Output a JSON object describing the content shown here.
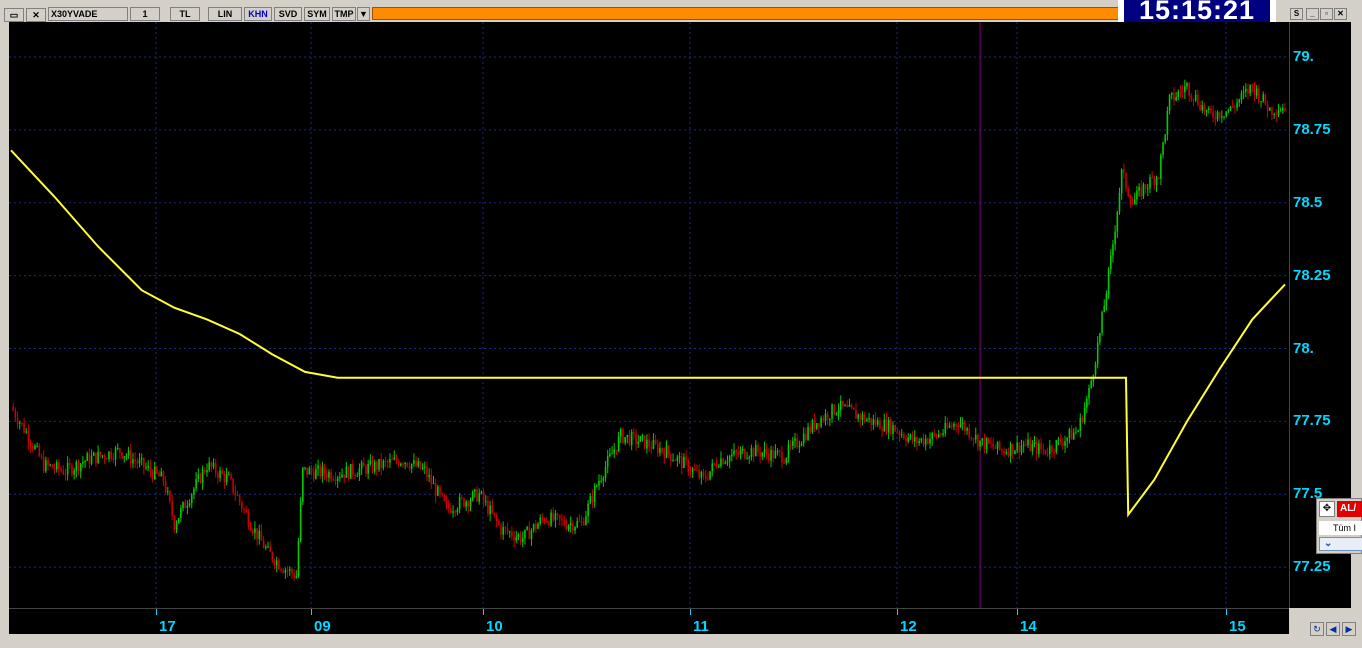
{
  "toolbar": {
    "symbol": "X30YVADE",
    "period": "1",
    "buttons": [
      "TL",
      "LIN",
      "KHN",
      "SVD",
      "SYM",
      "TMP"
    ],
    "active_button": "KHN",
    "dropdown_arrow": "chevron-down-icon"
  },
  "clock": {
    "time": "15:15:21"
  },
  "window_controls": {
    "s_label": "S",
    "minimize": "_",
    "restore": "▫",
    "close": "✕"
  },
  "right_panel": {
    "al_label": "AL/",
    "list_label": "Tüm I"
  },
  "colors": {
    "background": "#000000",
    "grid": "#1a2a80",
    "axis_text": "#00d8ff",
    "candle_up": "#00cc00",
    "candle_down": "#cc0000",
    "moving_average": "#ffff33",
    "cursor_line": "#800080",
    "toolbar_orange": "#ff8c00",
    "clock_bg": "#000080"
  },
  "chart_data": {
    "type": "candlestick",
    "symbol": "X30YVADE",
    "y_ticks": [
      "79.",
      "78.75",
      "78.5",
      "78.25",
      "78.",
      "77.75",
      "77.5",
      "77.25"
    ],
    "y_tick_values": [
      79.0,
      78.75,
      78.5,
      78.25,
      78.0,
      77.75,
      77.5,
      77.25
    ],
    "ylim": [
      77.11,
      79.12
    ],
    "x_ticks": [
      "17",
      "09",
      "10",
      "11",
      "12",
      "14",
      "15"
    ],
    "grid": true,
    "close_path": [
      [
        0,
        77.8
      ],
      [
        8,
        77.7
      ],
      [
        15,
        77.6
      ],
      [
        25,
        77.58
      ],
      [
        35,
        77.62
      ],
      [
        50,
        77.65
      ],
      [
        60,
        77.6
      ],
      [
        70,
        77.55
      ],
      [
        75,
        77.4
      ],
      [
        90,
        77.6
      ],
      [
        100,
        77.55
      ],
      [
        110,
        77.4
      ],
      [
        118,
        77.3
      ],
      [
        125,
        77.25
      ],
      [
        131,
        77.22
      ],
      [
        134,
        77.58
      ],
      [
        150,
        77.57
      ],
      [
        170,
        77.6
      ],
      [
        180,
        77.62
      ],
      [
        190,
        77.58
      ],
      [
        200,
        77.45
      ],
      [
        215,
        77.5
      ],
      [
        225,
        77.38
      ],
      [
        235,
        77.35
      ],
      [
        245,
        77.42
      ],
      [
        255,
        77.4
      ],
      [
        262,
        77.4
      ],
      [
        270,
        77.55
      ],
      [
        280,
        77.7
      ],
      [
        290,
        77.68
      ],
      [
        300,
        77.65
      ],
      [
        310,
        77.6
      ],
      [
        318,
        77.55
      ],
      [
        325,
        77.62
      ],
      [
        340,
        77.65
      ],
      [
        355,
        77.63
      ],
      [
        370,
        77.75
      ],
      [
        380,
        77.8
      ],
      [
        395,
        77.75
      ],
      [
        405,
        77.73
      ],
      [
        415,
        77.68
      ],
      [
        425,
        77.7
      ],
      [
        435,
        77.75
      ],
      [
        445,
        77.68
      ],
      [
        455,
        77.65
      ],
      [
        465,
        77.67
      ],
      [
        475,
        77.65
      ],
      [
        482,
        77.68
      ],
      [
        490,
        77.72
      ],
      [
        495,
        77.85
      ],
      [
        500,
        78.05
      ],
      [
        505,
        78.3
      ],
      [
        510,
        78.6
      ],
      [
        515,
        78.5
      ],
      [
        520,
        78.55
      ],
      [
        527,
        78.6
      ],
      [
        532,
        78.85
      ],
      [
        540,
        78.9
      ],
      [
        550,
        78.8
      ],
      [
        560,
        78.82
      ],
      [
        570,
        78.9
      ],
      [
        578,
        78.82
      ],
      [
        585,
        78.83
      ]
    ],
    "moving_average": [
      [
        0,
        78.68
      ],
      [
        20,
        78.52
      ],
      [
        40,
        78.35
      ],
      [
        60,
        78.2
      ],
      [
        75,
        78.14
      ],
      [
        90,
        78.1
      ],
      [
        105,
        78.05
      ],
      [
        120,
        77.98
      ],
      [
        135,
        77.92
      ],
      [
        150,
        77.9
      ],
      [
        200,
        77.9
      ],
      [
        300,
        77.9
      ],
      [
        400,
        77.9
      ],
      [
        480,
        77.9
      ],
      [
        512,
        77.9
      ],
      [
        513,
        77.43
      ],
      [
        525,
        77.55
      ],
      [
        540,
        77.75
      ],
      [
        555,
        77.93
      ],
      [
        570,
        78.1
      ],
      [
        585,
        78.22
      ]
    ],
    "cursor_bar": 445
  }
}
